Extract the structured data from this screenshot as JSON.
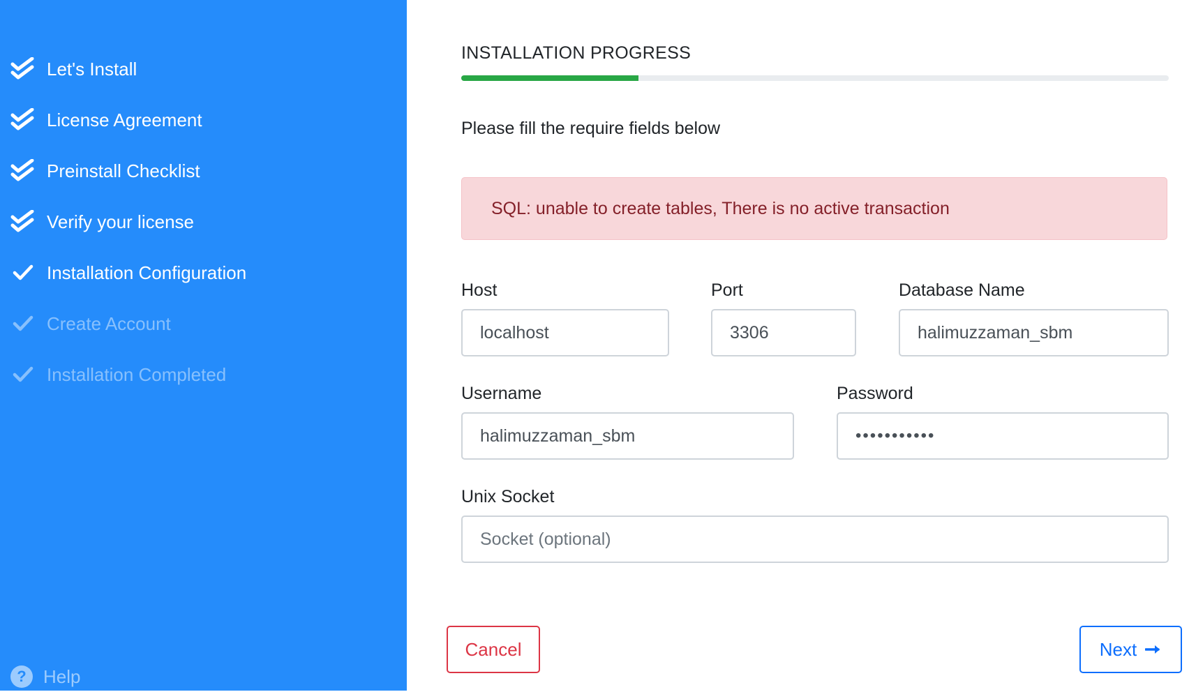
{
  "sidebar": {
    "steps": [
      {
        "label": "Let's Install",
        "status": "done",
        "icon": "double-check-icon"
      },
      {
        "label": "License Agreement",
        "status": "done",
        "icon": "double-check-icon"
      },
      {
        "label": "Preinstall Checklist",
        "status": "done",
        "icon": "double-check-icon"
      },
      {
        "label": "Verify your license",
        "status": "done",
        "icon": "double-check-icon"
      },
      {
        "label": "Installation Configuration",
        "status": "current",
        "icon": "check-icon"
      },
      {
        "label": "Create Account",
        "status": "pending",
        "icon": "check-icon"
      },
      {
        "label": "Installation Completed",
        "status": "pending",
        "icon": "check-icon"
      }
    ],
    "help_label": "Help",
    "help_icon": "question-circle-icon"
  },
  "header": {
    "title": "INSTALLATION PROGRESS",
    "progress_fraction": 0.25
  },
  "form": {
    "instruction": "Please fill the require fields below",
    "error": "SQL: unable to create tables, There is no active transaction",
    "host": {
      "label": "Host",
      "value": "localhost"
    },
    "port": {
      "label": "Port",
      "value": "3306"
    },
    "database": {
      "label": "Database Name",
      "value": "halimuzzaman_sbm"
    },
    "username": {
      "label": "Username",
      "value": "halimuzzaman_sbm"
    },
    "password": {
      "label": "Password",
      "value": "•••••••••••"
    },
    "socket": {
      "label": "Unix Socket",
      "placeholder": "Socket (optional)"
    }
  },
  "buttons": {
    "cancel": "Cancel",
    "next": "Next",
    "next_icon": "arrow-right-icon"
  },
  "colors": {
    "sidebar_bg": "#258cfb",
    "progress": "#28a745",
    "danger": "#dc3545",
    "primary": "#0d6efd",
    "alert_bg": "#f8d7da"
  }
}
